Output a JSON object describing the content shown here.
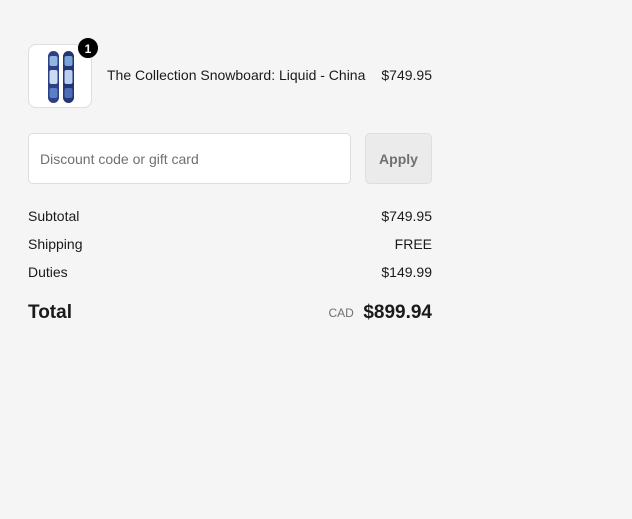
{
  "line_item": {
    "quantity": "1",
    "name": "The Collection Snowboard: Liquid - China",
    "price": "$749.95",
    "image_icon": "snowboard-product-image"
  },
  "discount": {
    "placeholder": "Discount code or gift card",
    "value": "",
    "apply_label": "Apply"
  },
  "summary": {
    "subtotal_label": "Subtotal",
    "subtotal_value": "$749.95",
    "shipping_label": "Shipping",
    "shipping_value": "FREE",
    "duties_label": "Duties",
    "duties_value": "$149.99"
  },
  "total": {
    "label": "Total",
    "currency": "CAD",
    "value": "$899.94"
  },
  "colors": {
    "page_background": "#f5f5f5",
    "badge_background": "#000000",
    "muted_text": "#707070",
    "border": "#dedede"
  }
}
